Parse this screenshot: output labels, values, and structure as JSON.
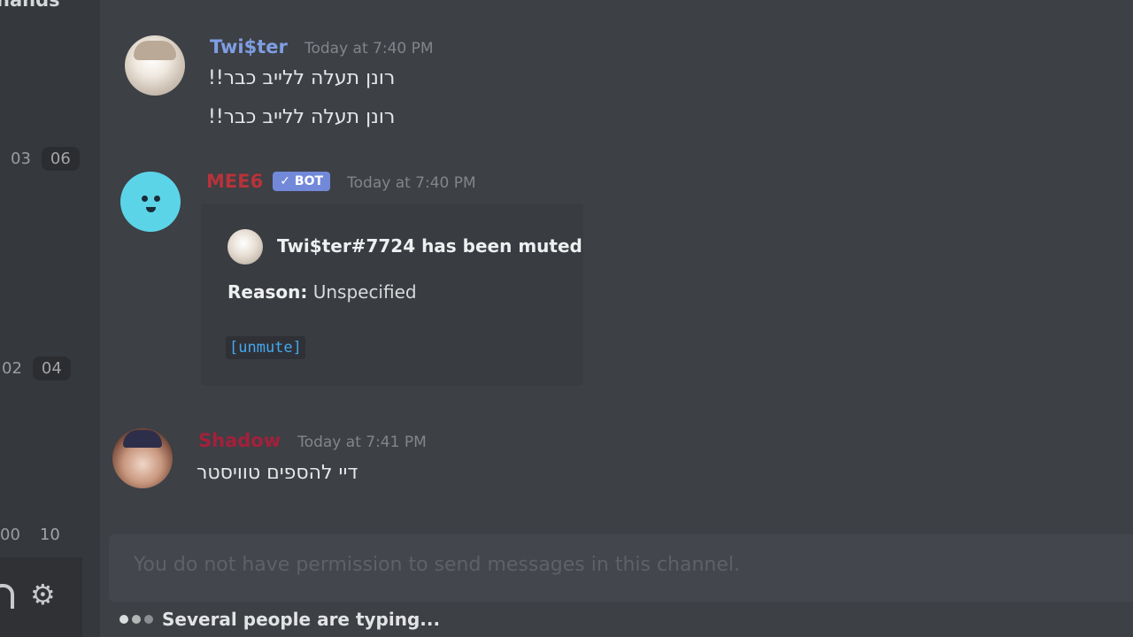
{
  "sidebar": {
    "channel_label_fragment": "hands",
    "pills": [
      {
        "a": "03",
        "b": "06"
      },
      {
        "a": "02",
        "b": "04"
      },
      {
        "a": "00",
        "b": "10"
      }
    ],
    "settings_icon": "gear-icon",
    "headset_icon": "headset-icon"
  },
  "messages": {
    "twister": {
      "username": "Twi$ter",
      "username_color": "#7f9ee3",
      "timestamp": "Today at 7:40 PM",
      "lines": [
        "רונן תעלה ללייב כבר!!",
        "רונן תעלה ללייב כבר!!"
      ]
    },
    "mee6": {
      "username": "MEE6",
      "username_color": "#b8323a",
      "bot_badge": "✓ BOT",
      "timestamp": "Today at 7:40 PM",
      "embed": {
        "title": "Twi$ter#7724 has been muted",
        "reason_label": "Reason:",
        "reason_value": "Unspecified",
        "link": "[unmute]"
      }
    },
    "shadow": {
      "username": "Shadow",
      "username_color": "#a3203b",
      "timestamp": "Today at 7:41 PM",
      "text": "דיי להספים טוויסטר"
    }
  },
  "composer": {
    "placeholder": "You do not have permission to send messages in this channel."
  },
  "typing": {
    "text": "Several people are typing..."
  }
}
